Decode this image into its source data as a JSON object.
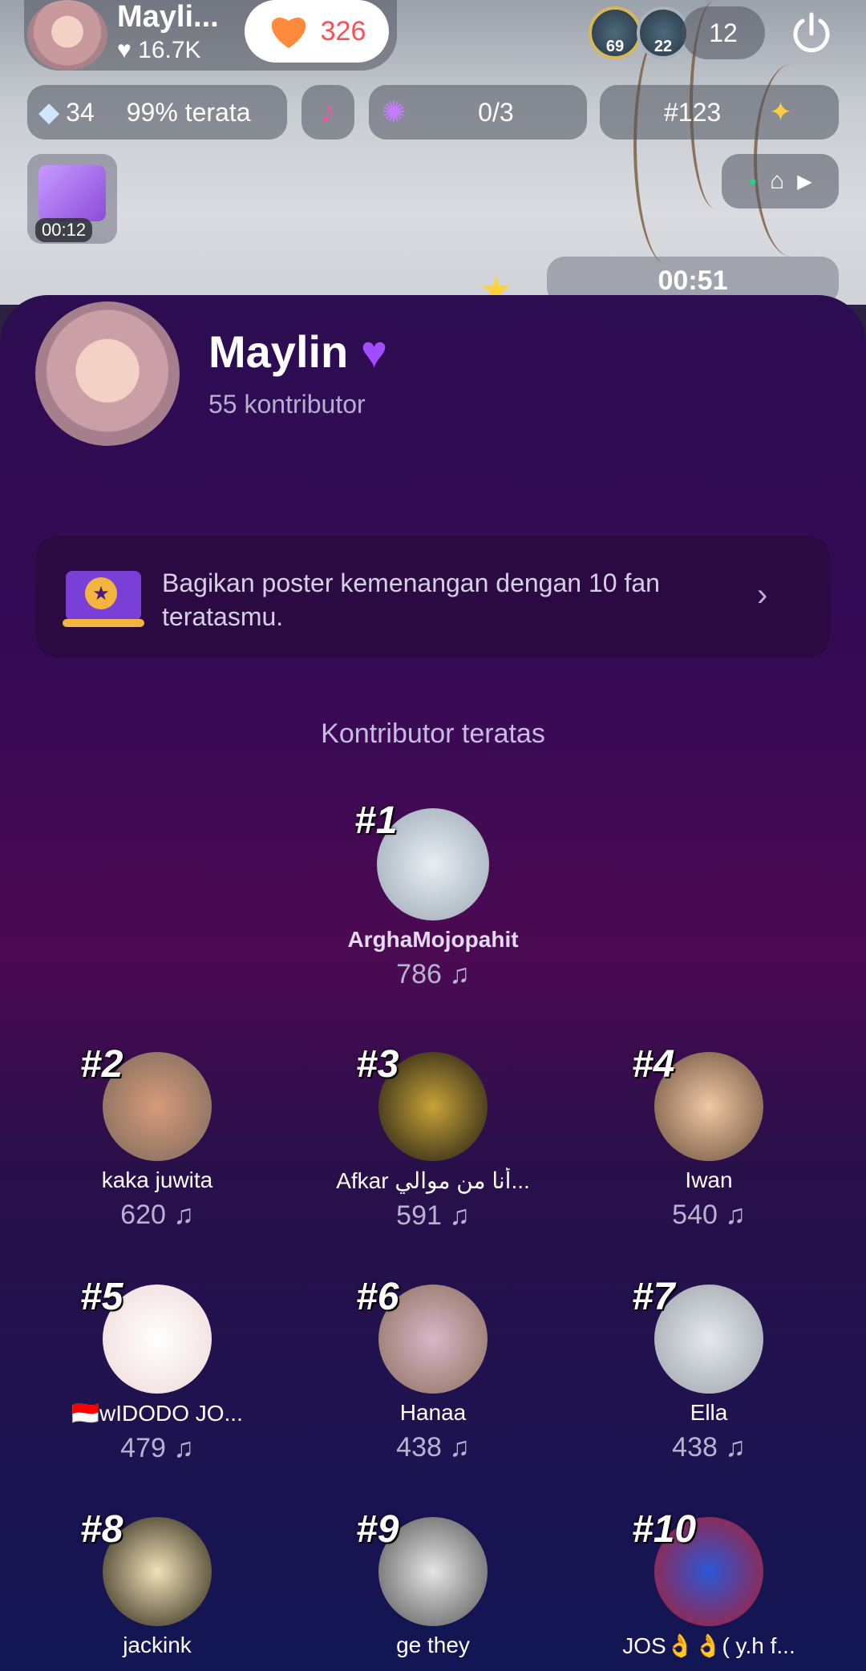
{
  "header": {
    "host_name": "Mayli...",
    "host_likes": "16.7K",
    "like_count": "326",
    "viewers": [
      {
        "badge": "69"
      },
      {
        "badge": "22"
      }
    ],
    "viewer_count": "12"
  },
  "stats_bar": {
    "diamonds": "34",
    "rank_text": "99% terata",
    "goal": "0/3",
    "rank_number": "#123"
  },
  "gift_timer": "00:12",
  "timer2": "00:51",
  "profile": {
    "name": "Maylin",
    "contributors": "55 kontributor"
  },
  "banner": {
    "text": "Bagikan poster kemenangan dengan 10 fan teratasmu."
  },
  "section_title": "Kontributor teratas",
  "contributors": [
    {
      "rank": "#1",
      "name": "ArghaMojopahit",
      "score": "786"
    },
    {
      "rank": "#2",
      "name": "kaka juwita",
      "score": "620"
    },
    {
      "rank": "#3",
      "name": "Afkar أنا من موالي...",
      "score": "591"
    },
    {
      "rank": "#4",
      "name": "Iwan",
      "score": "540"
    },
    {
      "rank": "#5",
      "name": "🇮🇩wIDODO JO...",
      "score": "479"
    },
    {
      "rank": "#6",
      "name": "Hanaa",
      "score": "438"
    },
    {
      "rank": "#7",
      "name": "Ella",
      "score": "438"
    },
    {
      "rank": "#8",
      "name": "jackink",
      "score": ""
    },
    {
      "rank": "#9",
      "name": "ge they",
      "score": ""
    },
    {
      "rank": "#10",
      "name": "JOS👌👌( y.h f...",
      "score": ""
    }
  ],
  "colors": {
    "accent": "#ff4d55",
    "panel_top": "#2c0d52",
    "panel_bottom": "#121654"
  }
}
